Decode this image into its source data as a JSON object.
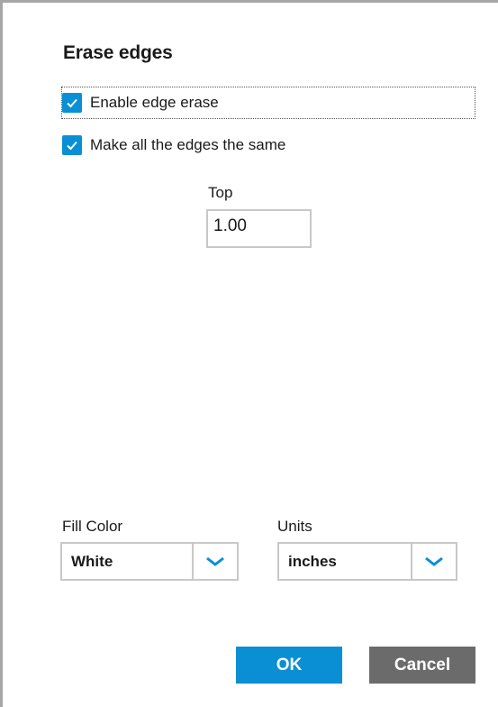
{
  "dialog": {
    "title": "Erase edges",
    "enable_edge_erase": {
      "label": "Enable edge erase",
      "checked": true
    },
    "same_edges": {
      "label": "Make all the edges the same",
      "checked": true
    },
    "top": {
      "label": "Top",
      "value": "1.00"
    },
    "fill_color": {
      "label": "Fill Color",
      "value": "White"
    },
    "units": {
      "label": "Units",
      "value": "inches"
    },
    "ok_label": "OK",
    "cancel_label": "Cancel"
  },
  "colors": {
    "accent": "#0a8fd4",
    "cancel": "#6b6b6b",
    "border": "#c8c8c8"
  },
  "icons": {
    "checkbox": "checkmark-icon",
    "dropdown": "chevron-down-icon"
  }
}
